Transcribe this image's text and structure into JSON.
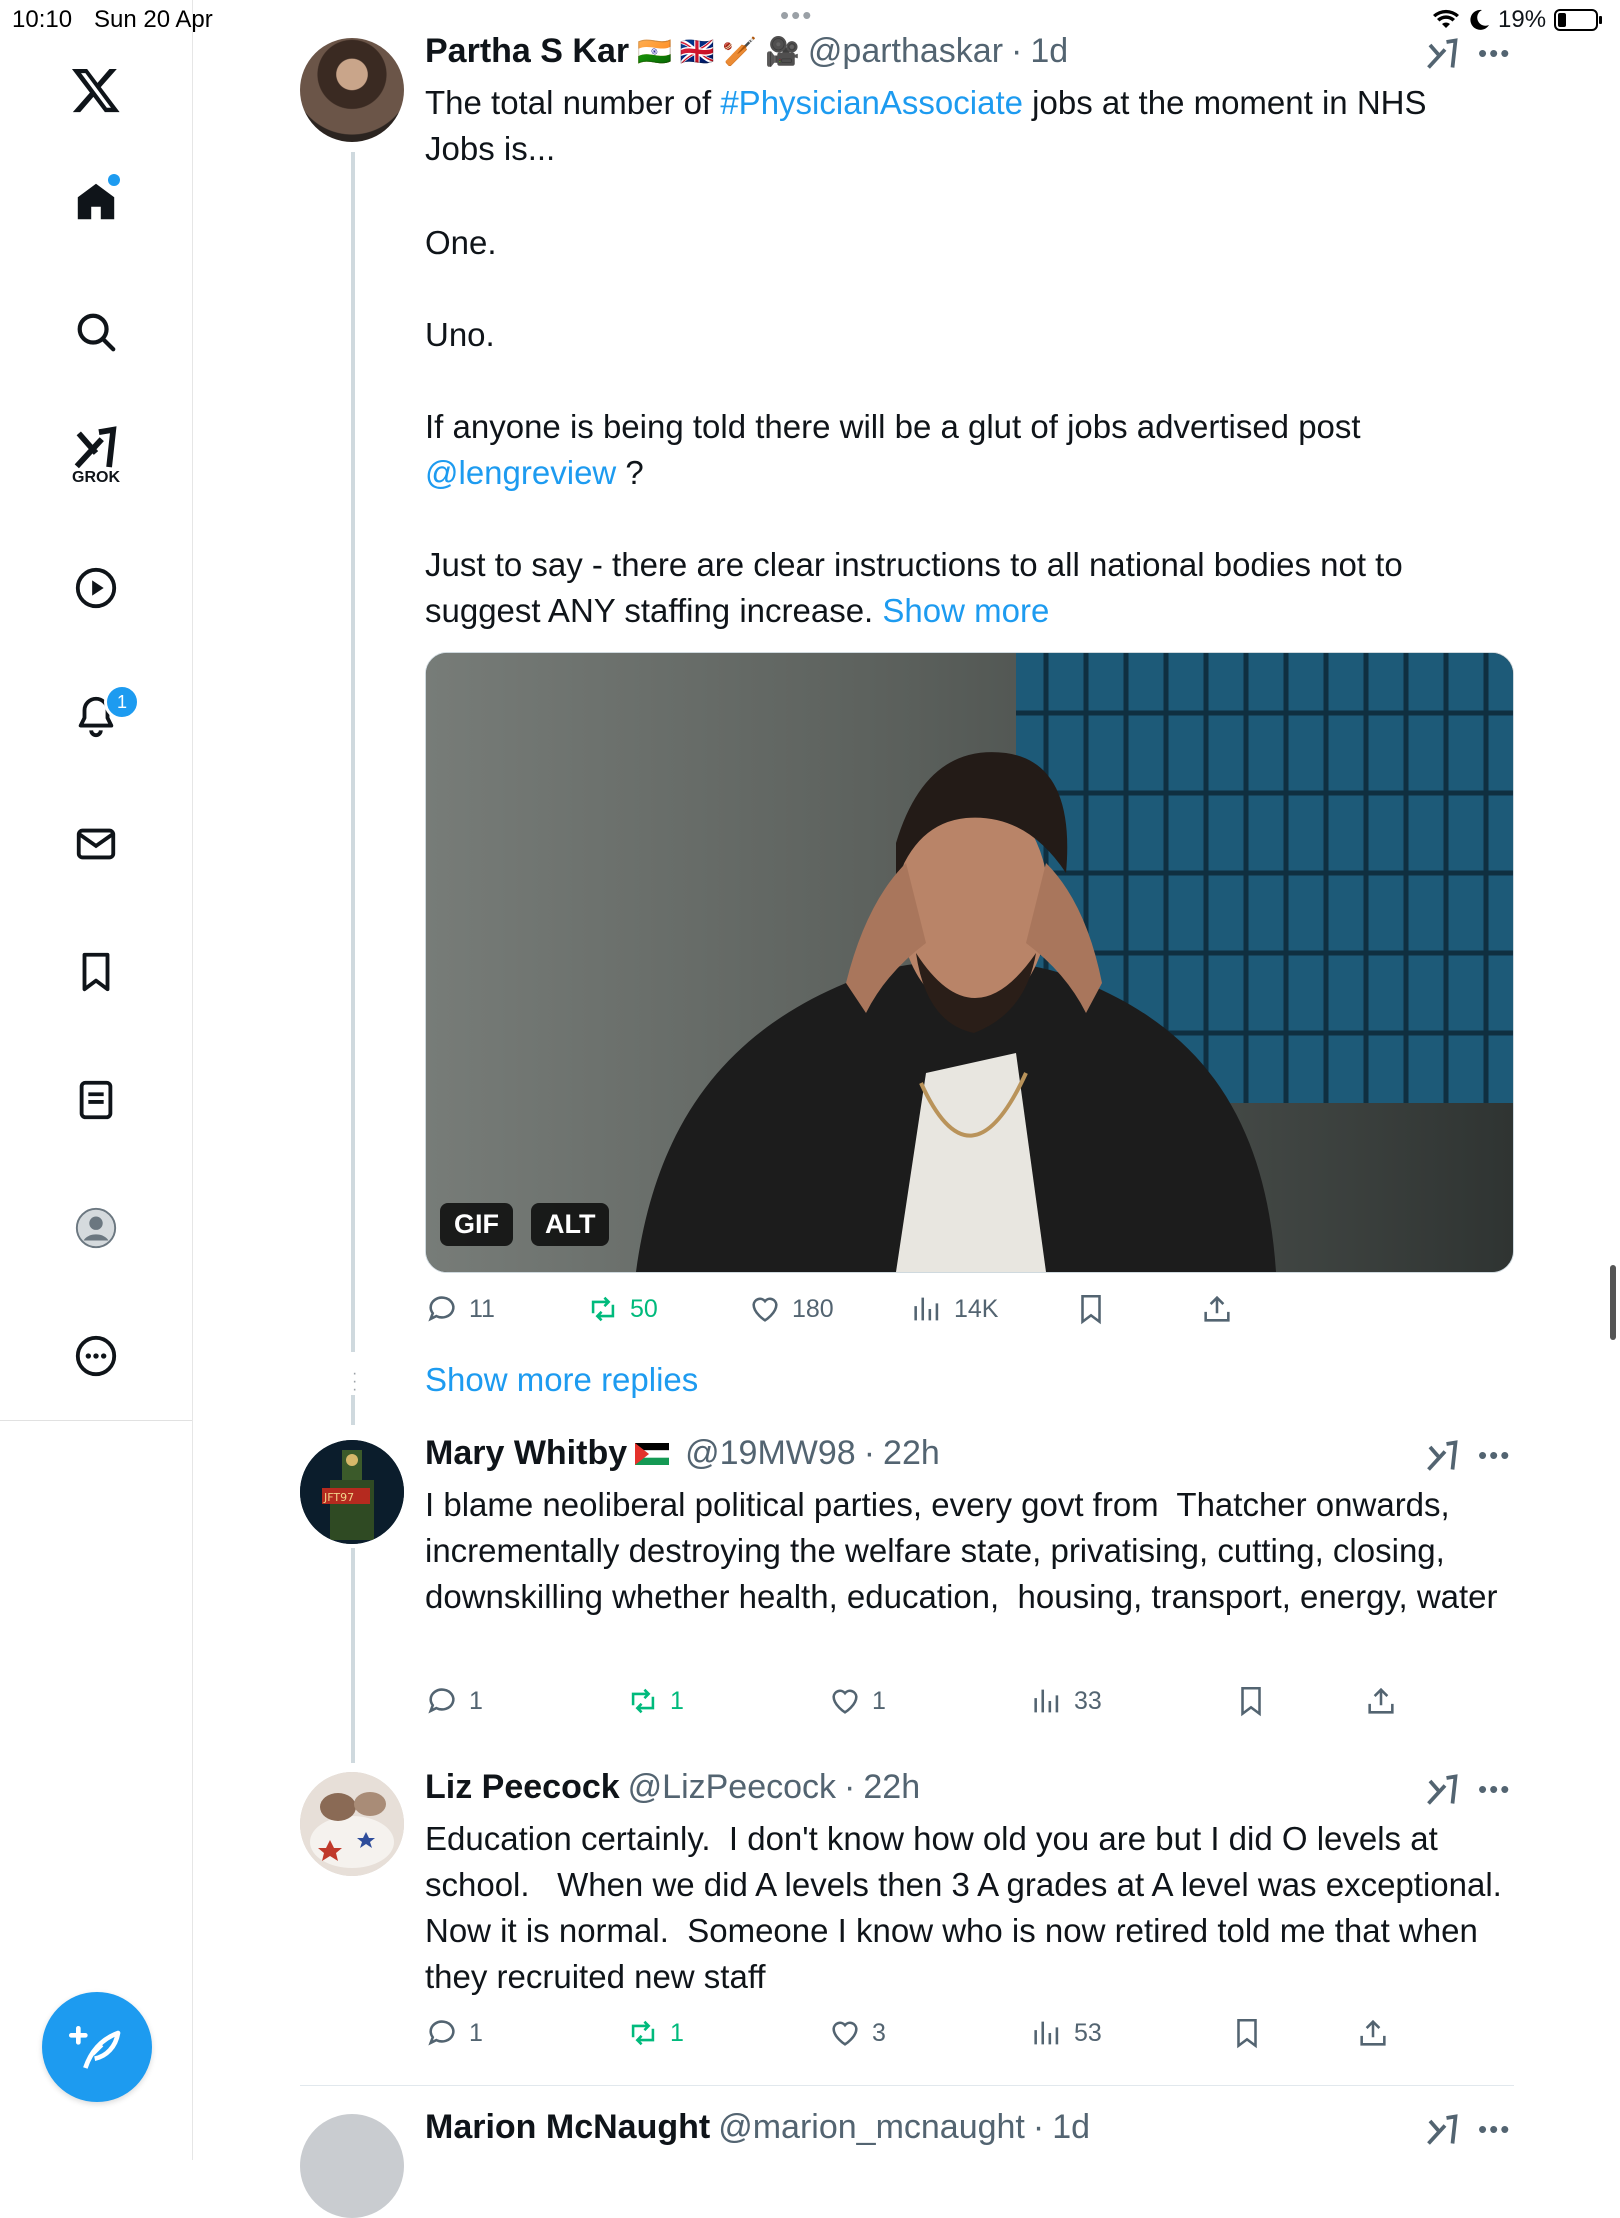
{
  "status_bar": {
    "time": "10:10",
    "date": "Sun 20 Apr",
    "battery": "19%"
  },
  "top_handle": "•••",
  "sidebar": {
    "grok_label": "GROK",
    "notifications_badge": "1",
    "items": [
      "home-icon",
      "search-icon",
      "grok-icon",
      "video-icon",
      "bell-icon",
      "mail-icon",
      "bookmark-icon",
      "lists-icon",
      "profile-icon",
      "more-icon"
    ]
  },
  "posts": [
    {
      "name": "Partha S Kar",
      "handle": "@parthaskar",
      "time": "1d",
      "text_before": "The total number of ",
      "hashtag": "#PhysicianAssociate",
      "text_after": " jobs at the moment in NHS Jobs is...",
      "line2": "One.",
      "line3": "Uno.",
      "line4_before": "If anyone is being told there will be a glut of jobs advertised post ",
      "mention": "@lengreview",
      "line4_after": " ?",
      "line5": "Just to say - there are clear instructions to all national bodies not to suggest ANY staffing increase. ",
      "show_more": "Show more",
      "media": {
        "gif_label": "GIF",
        "alt_label": "ALT"
      },
      "replies": "11",
      "reposts": "50",
      "likes": "180",
      "views": "14K"
    },
    {
      "show_more_replies": "Show more replies"
    },
    {
      "name": "Mary Whitby",
      "handle": "@19MW98",
      "time": "22h",
      "avatar_text": "JFT97",
      "text": "I blame neoliberal political parties, every govt from  Thatcher onwards, incrementally destroying the welfare state, privatising, cutting, closing, downskilling whether health, education,  housing, transport, energy, water",
      "replies": "1",
      "reposts": "1",
      "likes": "1",
      "views": "33"
    },
    {
      "name": "Liz Peecock",
      "handle": "@LizPeecock",
      "time": "22h",
      "text": "Education certainly.  I don't know how old you are but I did O levels at school.   When we did A levels then 3 A grades at A level was exceptional.  Now it is normal.  Someone I know who is now retired told me that when they recruited new staff",
      "replies": "1",
      "reposts": "1",
      "likes": "3",
      "views": "53"
    },
    {
      "name": "Marion McNaught",
      "handle": "@marion_mcnaught",
      "time": "1d"
    }
  ],
  "colors": {
    "accent": "#1d9bf0",
    "repost": "#00ba7c",
    "muted": "#536471",
    "text": "#0f1419"
  }
}
